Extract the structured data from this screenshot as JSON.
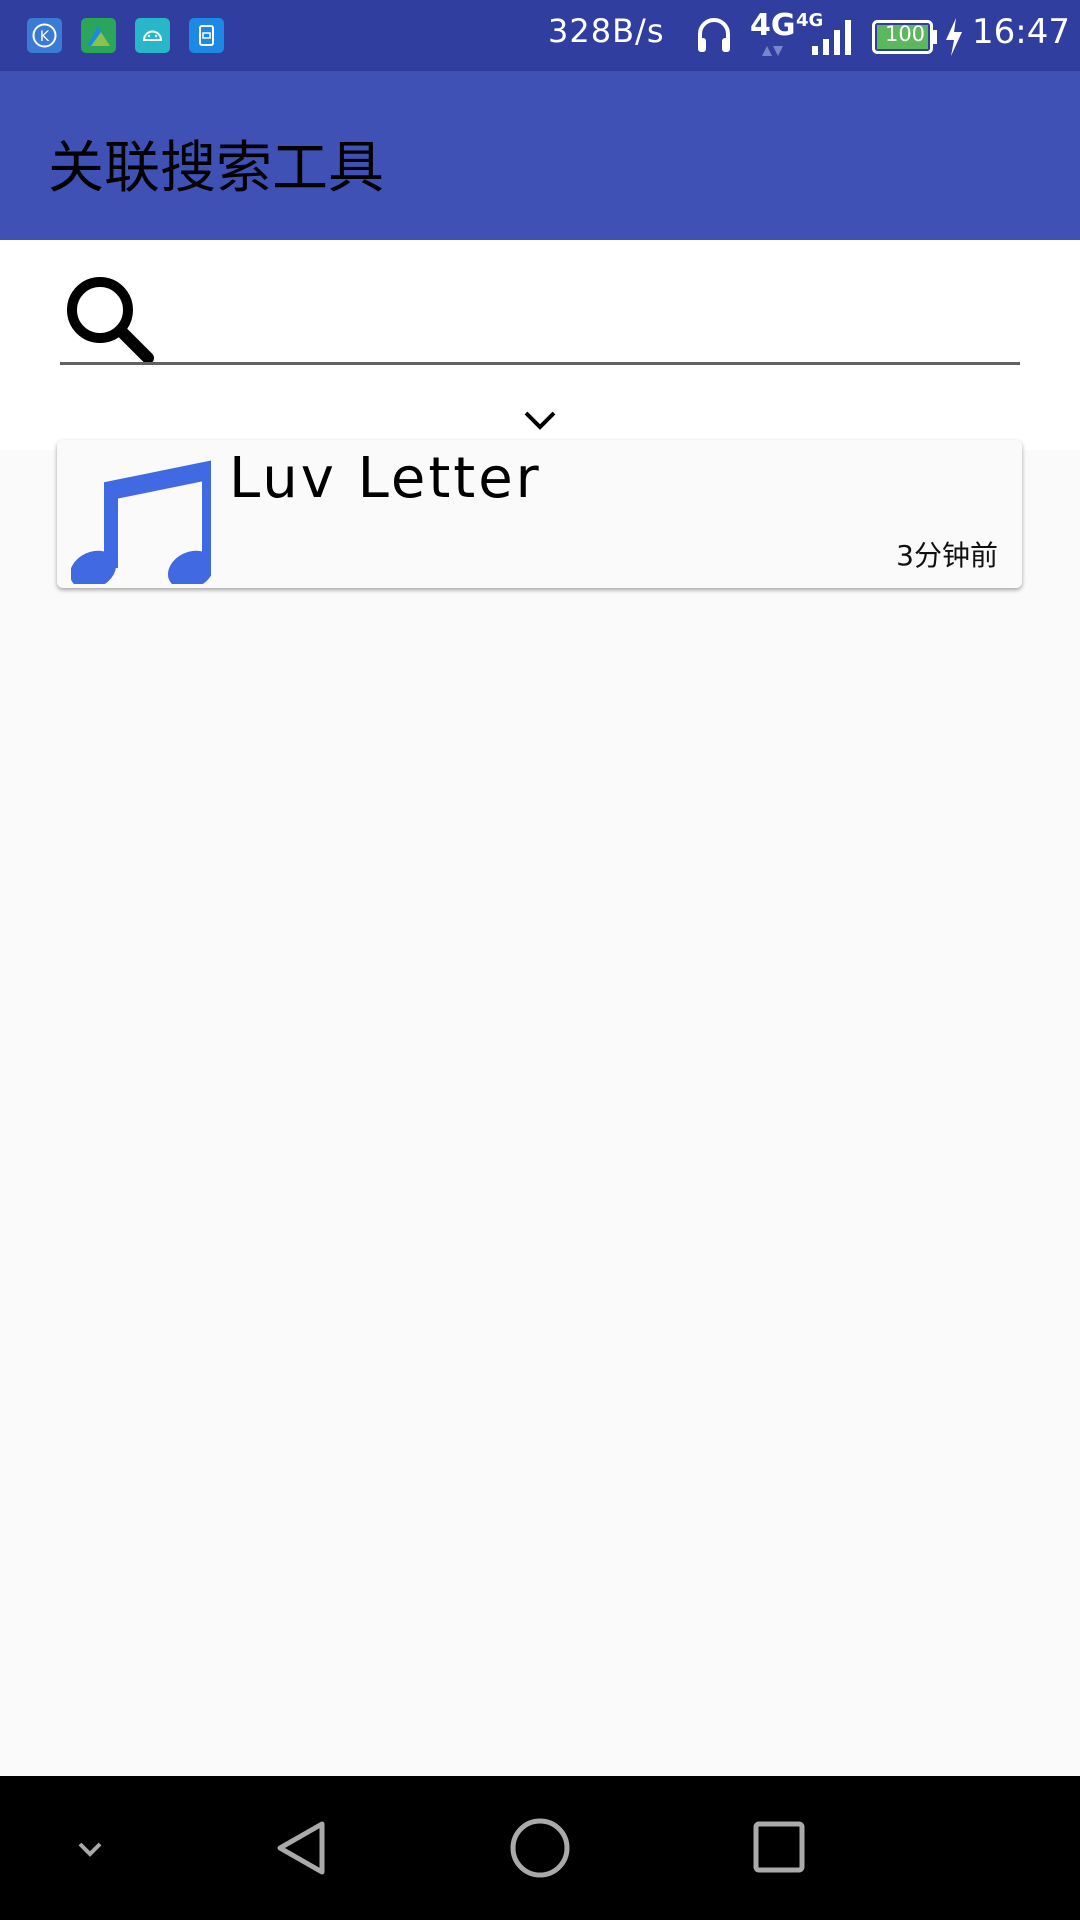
{
  "status_bar": {
    "network_speed": "328B/s",
    "network_type_1": "4G",
    "network_type_2": "4G",
    "battery_level": "100",
    "time": "16:47",
    "notification_icons": [
      "k-app-icon",
      "maps-app-icon",
      "android-app-icon",
      "sim-app-icon"
    ]
  },
  "app_bar": {
    "title": "关联搜索工具"
  },
  "search": {
    "value": "",
    "placeholder": ""
  },
  "results": [
    {
      "title": "Luv Letter",
      "time": "3分钟前",
      "icon": "music-note-icon"
    }
  ],
  "colors": {
    "status_bar": "#303f9f",
    "app_bar": "#3f51b5",
    "music_icon": "#4169e1",
    "battery": "#5cb85c"
  }
}
